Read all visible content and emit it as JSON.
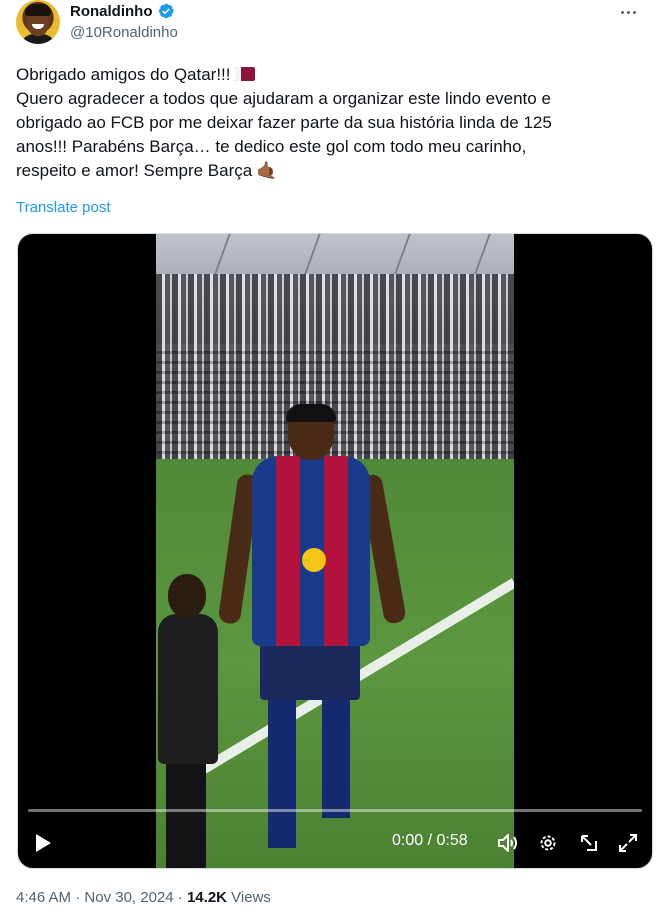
{
  "author": {
    "display_name": "Ronaldinho",
    "handle": "@10Ronaldinho",
    "verified": true,
    "avatar_icon": "avatar-photo"
  },
  "post": {
    "lines": [
      "Obrigado amigos do Qatar!!!",
      "Quero agradecer a todos que ajudaram a organizar este lindo evento e",
      "obrigado ao FCB por me deixar fazer parte da sua história linda de 125",
      "anos!!! Parabéns Barça… te dedico este gol com todo meu carinho,",
      "respeito e amor! Sempre Barça"
    ],
    "flag_emoji_icon": "qatar-flag-icon",
    "hand_emoji": "🤙🏾",
    "translate_label": "Translate post"
  },
  "video": {
    "elapsed": "0:00",
    "separator": "/",
    "duration": "0:58",
    "progress_fraction": 0.0,
    "controls": [
      "play-icon",
      "volume-icon",
      "settings-icon",
      "pip-icon",
      "fullscreen-icon"
    ]
  },
  "meta": {
    "time": "4:46 AM",
    "date": "Nov 30, 2024",
    "views_count": "14.2K",
    "views_label": "Views",
    "dot": "·"
  },
  "colors": {
    "text": "#0f1419",
    "secondary": "#536471",
    "link": "#1d9bf0",
    "verified": "#1d9bf0"
  }
}
